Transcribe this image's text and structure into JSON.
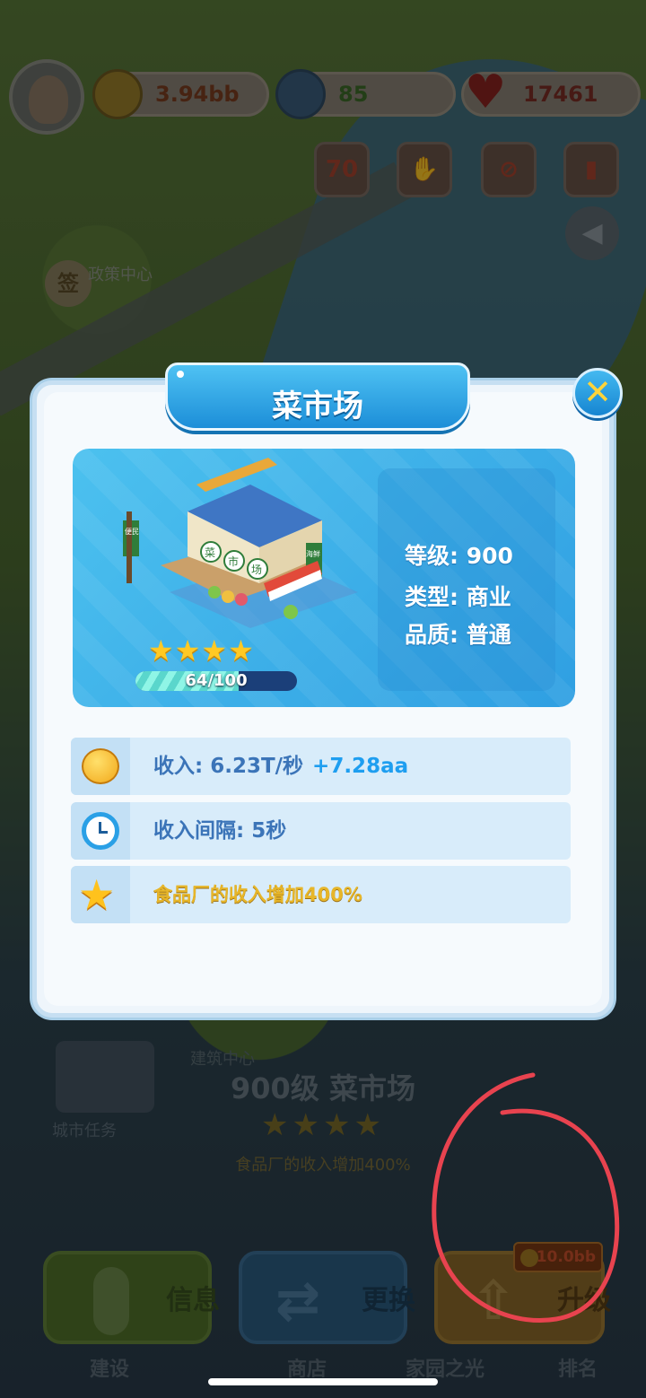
{
  "status_bar": {
    "coins": "3.94bb",
    "gems": "85",
    "hearts": "17461"
  },
  "top_icons": [
    {
      "name": "event-70-icon",
      "label": "70"
    },
    {
      "name": "handshake-icon",
      "label": ""
    },
    {
      "name": "no-smoking-icon",
      "label": ""
    },
    {
      "name": "traffic-light-icon",
      "label": ""
    }
  ],
  "world": {
    "sign_badge": "签",
    "policy_center": "政策中心"
  },
  "modal": {
    "title": "菜市场",
    "building_signs": {
      "left": "便民",
      "right": "海鲜",
      "circles": [
        "菜",
        "市",
        "场"
      ]
    },
    "stars": 4,
    "stars_text": "★★★★",
    "progress": {
      "current": 64,
      "max": 100,
      "text": "64/100"
    },
    "stats": {
      "level": "等级: 900",
      "type": "类型: 商业",
      "quality": "品质: 普通"
    },
    "rows": {
      "income": "收入: 6.23T/秒",
      "income_plus": "+7.28aa",
      "interval": "收入间隔: 5秒",
      "bonus": "食品厂的收入增加400%"
    },
    "close_symbol": "✕"
  },
  "bottom": {
    "build_center": "建筑中心",
    "city_task": "城市任务",
    "title": "900级 菜市场",
    "stars_text": "★★★★",
    "bonus": "食品厂的收入增加400%",
    "buttons": {
      "info": "信息",
      "swap": "更换",
      "upgrade": "升级"
    },
    "upgrade_price": "10.0bb",
    "nav": {
      "build": "建设",
      "shop": "商店",
      "home": "家园之光",
      "rank": "排名"
    }
  },
  "colors": {
    "accent": "#2f9fe2",
    "star": "#ffc924",
    "annotation": "#e8434f"
  }
}
